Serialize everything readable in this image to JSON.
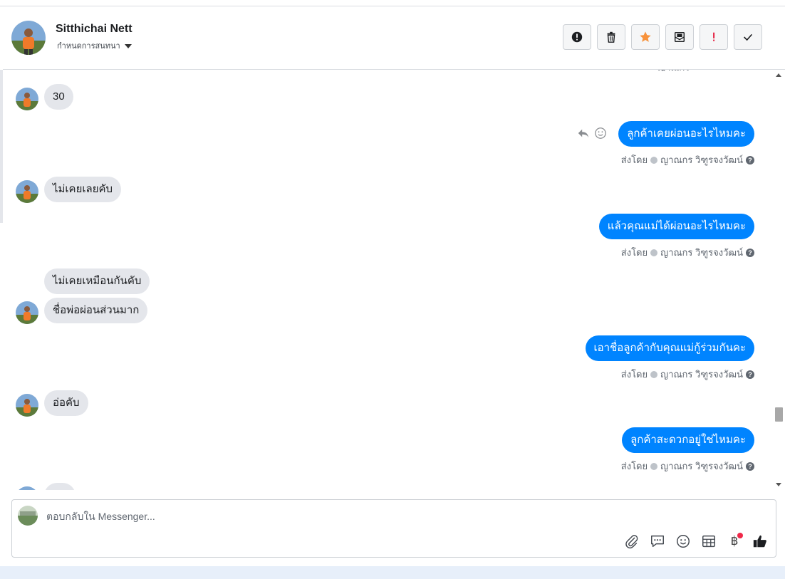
{
  "header": {
    "contact_name": "Sitthichai Nett",
    "subtitle": "กำหนดการสนทนา",
    "actions": [
      {
        "name": "spam-button",
        "icon": "exclamation-circle-icon"
      },
      {
        "name": "delete-button",
        "icon": "trash-icon"
      },
      {
        "name": "star-button",
        "icon": "star-icon",
        "color": "#f7923b"
      },
      {
        "name": "mark-unread-button",
        "icon": "envelope-open-icon"
      },
      {
        "name": "important-button",
        "icon": "exclamation-mark-icon",
        "color": "#e41e3f"
      },
      {
        "name": "done-button",
        "icon": "check-icon"
      }
    ]
  },
  "messages": [
    {
      "dir": "in",
      "text": "30"
    },
    {
      "dir": "out",
      "text": "ลูกค้าเคยผ่อนอะไรไหมคะ",
      "sent_by_label": "ส่งโดย",
      "sender": "ญาณกร วิฑูรจงวัฒน์"
    },
    {
      "dir": "in",
      "text": "ไม่เคยเลยคับ"
    },
    {
      "dir": "out",
      "text": "แล้วคุณแม่ได้ผ่อนอะไรไหมคะ",
      "sent_by_label": "ส่งโดย",
      "sender": "ญาณกร วิฑูรจงวัฒน์"
    },
    {
      "dir": "in",
      "text": "ไม่เคยเหมือนกันคับ"
    },
    {
      "dir": "in",
      "text": "ชื่อพ่อผ่อนส่วนมาก"
    },
    {
      "dir": "out",
      "text": "เอาชื่อลูกค้ากับคุณแม่กู้ร่วมกันคะ",
      "sent_by_label": "ส่งโดย",
      "sender": "ญาณกร วิฑูรจงวัฒน์"
    },
    {
      "dir": "in",
      "text": "อ่อคับ"
    },
    {
      "dir": "out",
      "text": "ลูกค้าสะดวกอยู่ใช่ไหมคะ",
      "sent_by_label": "ส่งโดย",
      "sender": "ญาณกร วิฑูรจงวัฒน์"
    }
  ],
  "composer": {
    "placeholder": "ตอบกลับใน Messenger...",
    "tools": [
      "attachment-icon",
      "saved-reply-icon",
      "emoji-icon",
      "table-icon",
      "baht-icon",
      "like-icon"
    ],
    "baht_symbol": "฿"
  },
  "colors": {
    "outgoing_bubble": "#0084ff",
    "incoming_bubble": "#e4e6eb",
    "notification_dot": "#f02849"
  }
}
